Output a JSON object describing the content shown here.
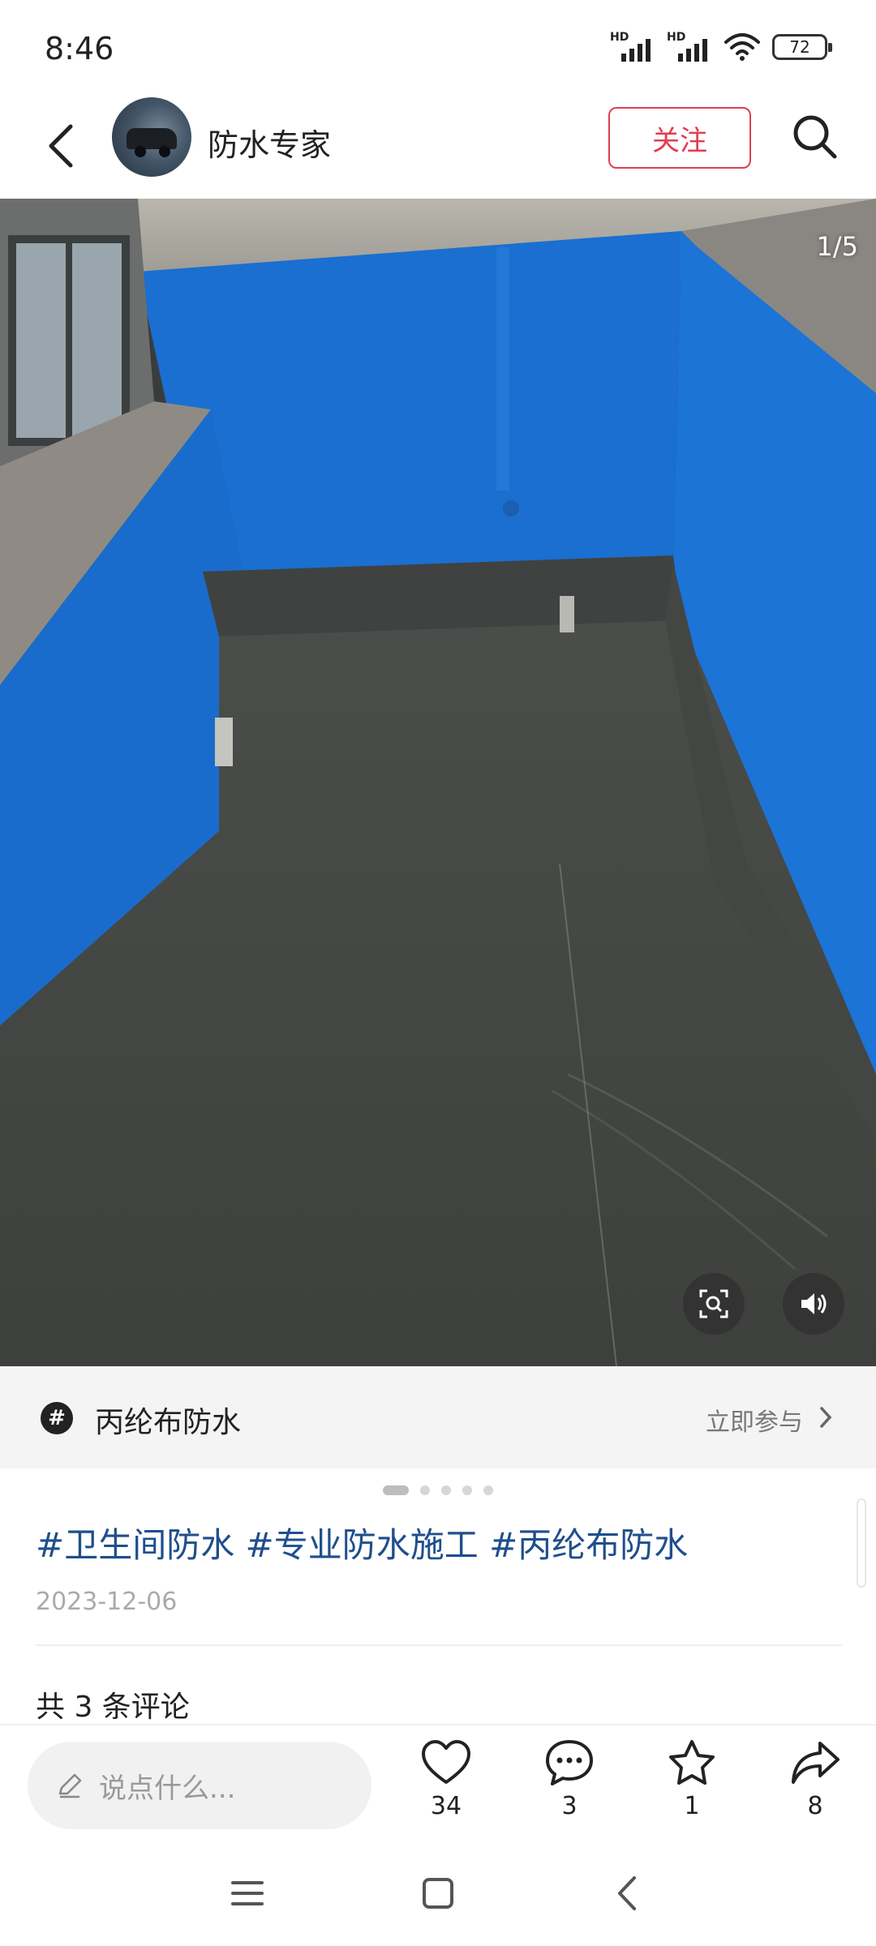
{
  "status_bar": {
    "time": "8:46",
    "battery": "72",
    "signal_label": "HD"
  },
  "header": {
    "author_name": "防水专家",
    "follow_label": "关注"
  },
  "media": {
    "counter": "1/5"
  },
  "topic": {
    "name": "丙纶布防水",
    "join_label": "立即参与"
  },
  "post": {
    "tags": "#卫生间防水 #专业防水施工 #丙纶布防水",
    "date": "2023-12-06",
    "comment_count": "共 3 条评论"
  },
  "pagination": {
    "total": 5,
    "active_index": 0
  },
  "action_bar": {
    "input_placeholder": "说点什么...",
    "likes": "34",
    "comments": "3",
    "favorites": "1",
    "shares": "8"
  },
  "colors": {
    "accent": "#e23d52",
    "tag_link": "#1f4f8c",
    "wall_blue": "#1a6fd0"
  },
  "icons": [
    "back-arrow-icon",
    "search-icon",
    "hashtag-icon",
    "chevron-right-icon",
    "scan-icon",
    "speaker-icon",
    "pencil-icon",
    "heart-icon",
    "comment-icon",
    "star-icon",
    "share-icon",
    "menu-icon",
    "home-square-icon",
    "nav-back-icon"
  ]
}
